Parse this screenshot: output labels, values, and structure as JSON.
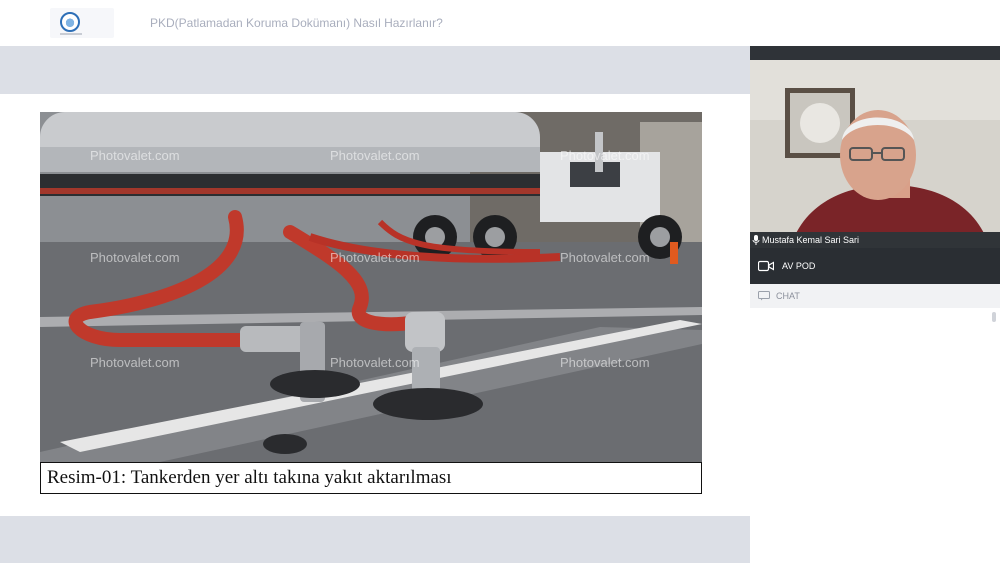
{
  "header": {
    "title": "PKD(Patlamadan Koruma Dokümanı) Nasıl Hazırlanır?",
    "logo": "organization-logo"
  },
  "slide": {
    "image": "fuel-tanker-hose-transfer-photo",
    "watermark": "Photovalet.com",
    "caption": "Resim-01: Tankerden yer altı takına yakıt aktarılması"
  },
  "video": {
    "presenter_name": "Mustafa Kemal Sari Sari",
    "mic_icon": "microphone-icon"
  },
  "panels": {
    "av_pod_label": "AV POD",
    "av_pod_icon": "camera-icon",
    "chat_label": "CHAT",
    "chat_icon": "chat-icon"
  },
  "colors": {
    "topbar_bg": "#ffffff",
    "stage_bg": "#dcdfe6",
    "panel_dark": "#2a2e33",
    "title_text": "#a9aebd",
    "hose_red": "#c0392b"
  }
}
